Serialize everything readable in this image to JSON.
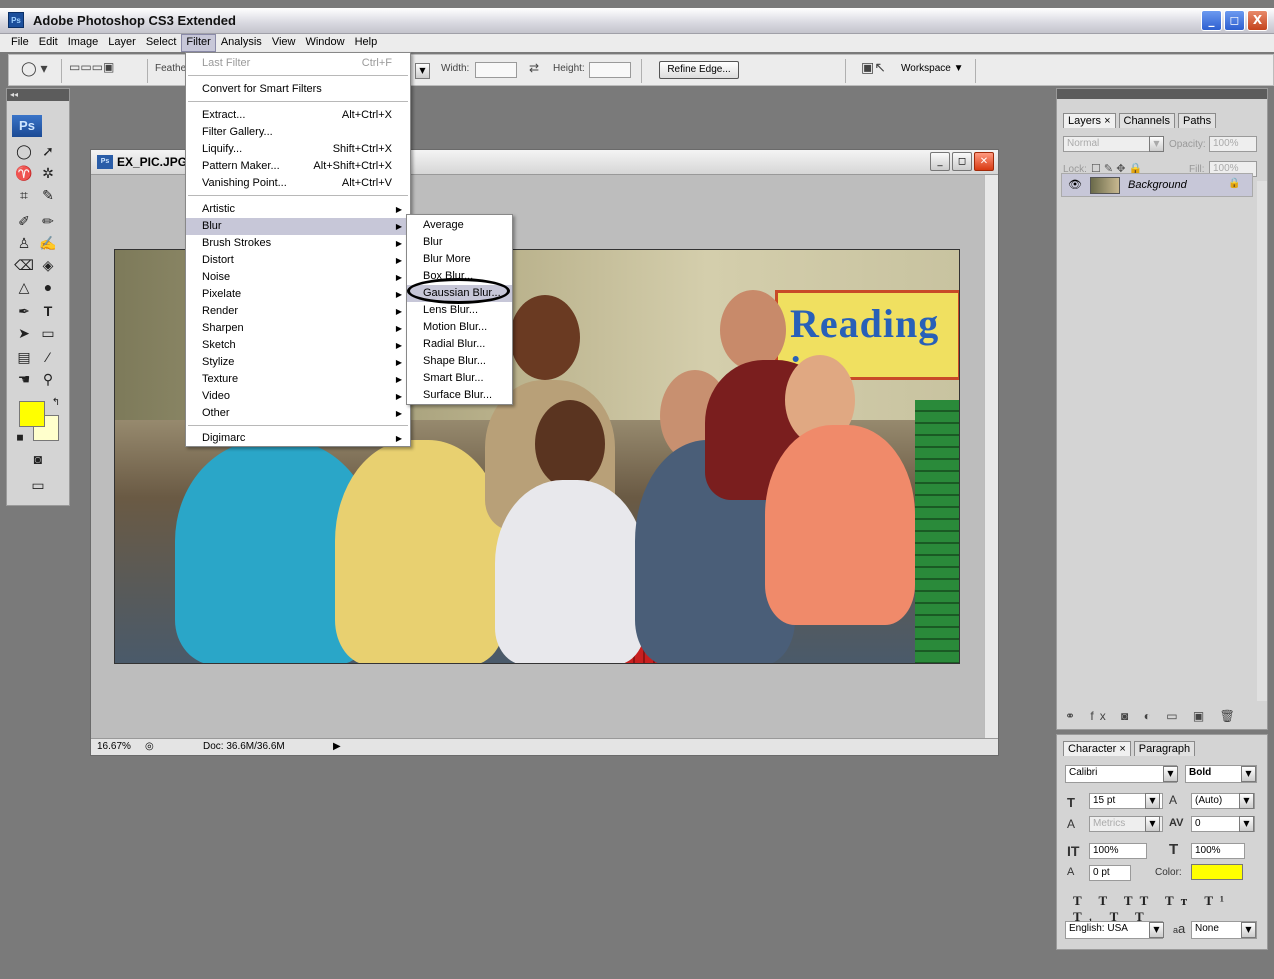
{
  "app": {
    "title": "Adobe Photoshop CS3 Extended",
    "icon_text": "Ps"
  },
  "window_buttons": {
    "minimize": "_",
    "maximize": "◻",
    "close": "X"
  },
  "menubar": [
    "File",
    "Edit",
    "Image",
    "Layer",
    "Select",
    "Filter",
    "Analysis",
    "View",
    "Window",
    "Help"
  ],
  "options": {
    "feather_label": "Feathe",
    "width_label": "Width:",
    "height_label": "Height:",
    "refine_edge": "Refine Edge...",
    "workspace": "Workspace ▼"
  },
  "tools": {
    "logo": "Ps"
  },
  "document": {
    "title": "EX_PIC.JPG",
    "zoom": "16.67%",
    "doc_size": "Doc: 36.6M/36.6M"
  },
  "photo": {
    "banner_text": "Reading i"
  },
  "filter_menu": {
    "items": [
      {
        "label": "Last Filter",
        "shortcut": "Ctrl+F",
        "disabled": true
      },
      {
        "label": "Convert for Smart Filters"
      },
      {
        "label": "Extract...",
        "shortcut": "Alt+Ctrl+X"
      },
      {
        "label": "Filter Gallery..."
      },
      {
        "label": "Liquify...",
        "shortcut": "Shift+Ctrl+X"
      },
      {
        "label": "Pattern Maker...",
        "shortcut": "Alt+Shift+Ctrl+X"
      },
      {
        "label": "Vanishing Point...",
        "shortcut": "Alt+Ctrl+V"
      },
      {
        "label": "Artistic",
        "submenu": true
      },
      {
        "label": "Blur",
        "submenu": true,
        "highlighted": true
      },
      {
        "label": "Brush Strokes",
        "submenu": true
      },
      {
        "label": "Distort",
        "submenu": true
      },
      {
        "label": "Noise",
        "submenu": true
      },
      {
        "label": "Pixelate",
        "submenu": true
      },
      {
        "label": "Render",
        "submenu": true
      },
      {
        "label": "Sharpen",
        "submenu": true
      },
      {
        "label": "Sketch",
        "submenu": true
      },
      {
        "label": "Stylize",
        "submenu": true
      },
      {
        "label": "Texture",
        "submenu": true
      },
      {
        "label": "Video",
        "submenu": true
      },
      {
        "label": "Other",
        "submenu": true
      },
      {
        "label": "Digimarc",
        "submenu": true
      }
    ]
  },
  "blur_submenu": {
    "items": [
      "Average",
      "Blur",
      "Blur More",
      "Box Blur...",
      "Gaussian Blur...",
      "Lens Blur...",
      "Motion Blur...",
      "Radial Blur...",
      "Shape Blur...",
      "Smart Blur...",
      "Surface Blur..."
    ],
    "circled": "Gaussian Blur..."
  },
  "layers_panel": {
    "tabs": [
      "Layers ×",
      "Channels",
      "Paths"
    ],
    "blend_mode": "Normal",
    "opacity_label": "Opacity:",
    "opacity": "100%",
    "lock_label": "Lock:",
    "fill_label": "Fill:",
    "fill": "100%",
    "layer_name": "Background"
  },
  "character_panel": {
    "tabs": [
      "Character ×",
      "Paragraph"
    ],
    "font_family": "Calibri",
    "font_style": "Bold",
    "font_size": "15 pt",
    "leading": "(Auto)",
    "kerning": "Metrics",
    "tracking": "0",
    "vertical_scale": "100%",
    "horizontal_scale": "100%",
    "baseline_shift": "0 pt",
    "color_label": "Color:",
    "text_color": "#ffff00",
    "language": "English: USA",
    "antialias_label": "a",
    "antialias": "None"
  },
  "colors": {
    "foreground": "#ffff00",
    "background": "#ffffcc",
    "menu_highlight": "#c7c7d8"
  }
}
